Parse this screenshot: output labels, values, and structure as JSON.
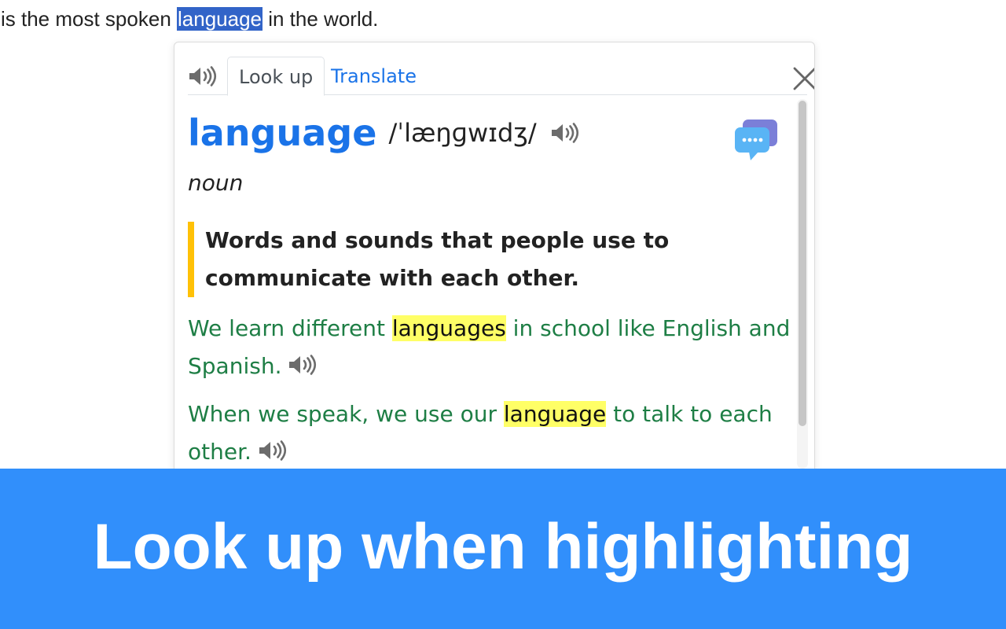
{
  "page": {
    "sentence_before": "is the most spoken ",
    "selected_word": "language",
    "sentence_after": " in the world."
  },
  "popup": {
    "tabs": {
      "lookup_label": "Look up",
      "translate_label": "Translate",
      "active": "Look up"
    },
    "entry": {
      "headword": "language",
      "phonetic": "/ˈlæŋɡwɪdʒ/",
      "part_of_speech": "noun",
      "definition": "Words and sounds that people use to communicate with each other.",
      "examples": [
        {
          "before": "We learn different ",
          "highlight": "languages",
          "after": " in school like English and Spanish."
        },
        {
          "before": "When we speak, we use our ",
          "highlight": "language",
          "after": " to talk to each other."
        }
      ]
    },
    "icons": {
      "speaker": "speaker-icon",
      "close": "close-icon",
      "chat": "chat-bubbles-icon"
    }
  },
  "banner": {
    "text": "Look up when highlighting"
  },
  "colors": {
    "accent": "#1a73e8",
    "example_text": "#1e7e45",
    "definition_bar": "#ffc107",
    "highlight": "#ffff66",
    "banner_bg": "#318ffb",
    "selection_bg": "#3264c8"
  }
}
